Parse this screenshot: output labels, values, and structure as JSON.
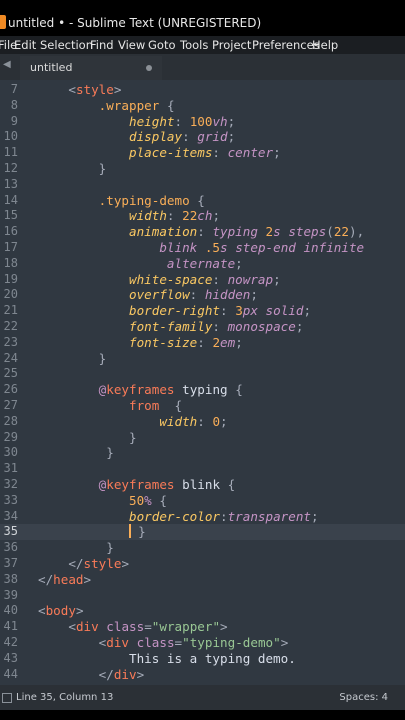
{
  "window": {
    "title": "untitled • - Sublime Text (UNREGISTERED)"
  },
  "menu": [
    "File",
    "Edit",
    "Selection",
    "Find",
    "View",
    "Goto",
    "Tools",
    "Project",
    "Preferences",
    "Help"
  ],
  "tab": {
    "label": "untitled"
  },
  "status": {
    "position": "Line 35, Column 13",
    "indentation": "Spaces: 4"
  },
  "active_line": 35,
  "code_lines": [
    {
      "n": 7,
      "html": "    <span class='angle'>&lt;</span><span class='tag'>style</span><span class='angle'>&gt;</span>"
    },
    {
      "n": 8,
      "html": "        <span class='sel'>.wrapper</span> <span class='punc'>{</span>"
    },
    {
      "n": 9,
      "html": "            <span class='prop'>height</span><span class='punc'>:</span> <span class='num'>100</span><span class='unit'>vh</span><span class='punc'>;</span>"
    },
    {
      "n": 10,
      "html": "            <span class='prop'>display</span><span class='punc'>:</span> <span class='val'>grid</span><span class='punc'>;</span>"
    },
    {
      "n": 11,
      "html": "            <span class='prop'>place-items</span><span class='punc'>:</span> <span class='val'>center</span><span class='punc'>;</span>"
    },
    {
      "n": 12,
      "html": "        <span class='punc'>}</span>"
    },
    {
      "n": 13,
      "html": ""
    },
    {
      "n": 14,
      "html": "        <span class='sel'>.typing-demo</span> <span class='punc'>{</span>"
    },
    {
      "n": 15,
      "html": "            <span class='prop'>width</span><span class='punc'>:</span> <span class='num'>22</span><span class='unit'>ch</span><span class='punc'>;</span>"
    },
    {
      "n": 16,
      "html": "            <span class='prop'>animation</span><span class='punc'>:</span> <span class='val'>typing</span> <span class='num'>2</span><span class='unit'>s</span> <span class='val'>steps</span><span class='punc'>(</span><span class='num'>22</span><span class='punc'>),</span>"
    },
    {
      "n": 17,
      "html": "                <span class='val'>blink</span> <span class='num'>.5</span><span class='unit'>s</span> <span class='val'>step-end</span> <span class='val'>infinite</span>"
    },
    {
      "n": 18,
      "html": "                 <span class='val'>alternate</span><span class='punc'>;</span>"
    },
    {
      "n": 19,
      "html": "            <span class='prop'>white-space</span><span class='punc'>:</span> <span class='val'>nowrap</span><span class='punc'>;</span>"
    },
    {
      "n": 20,
      "html": "            <span class='prop'>overflow</span><span class='punc'>:</span> <span class='val'>hidden</span><span class='punc'>;</span>"
    },
    {
      "n": 21,
      "html": "            <span class='prop'>border-right</span><span class='punc'>:</span> <span class='num'>3</span><span class='unit'>px</span> <span class='val'>solid</span><span class='punc'>;</span>"
    },
    {
      "n": 22,
      "html": "            <span class='prop'>font-family</span><span class='punc'>:</span> <span class='val'>monospace</span><span class='punc'>;</span>"
    },
    {
      "n": 23,
      "html": "            <span class='prop'>font-size</span><span class='punc'>:</span> <span class='num'>2</span><span class='unit'>em</span><span class='punc'>;</span>"
    },
    {
      "n": 24,
      "html": "        <span class='punc'>}</span>"
    },
    {
      "n": 25,
      "html": ""
    },
    {
      "n": 26,
      "html": "        <span class='at'>@</span><span class='tag'>keyframes</span> <span class='txt'>typing</span> <span class='punc'>{</span>"
    },
    {
      "n": 27,
      "html": "            <span class='tag'>from</span>  <span class='punc'>{</span>"
    },
    {
      "n": 28,
      "html": "                <span class='prop'>width</span><span class='punc'>:</span> <span class='num'>0</span><span class='punc'>;</span>"
    },
    {
      "n": 29,
      "html": "            <span class='punc'>}</span>"
    },
    {
      "n": 30,
      "html": "         <span class='punc'>}</span>"
    },
    {
      "n": 31,
      "html": ""
    },
    {
      "n": 32,
      "html": "        <span class='at'>@</span><span class='tag'>keyframes</span> <span class='txt'>blink</span> <span class='punc'>{</span>"
    },
    {
      "n": 33,
      "html": "            <span class='num'>50</span><span class='unit'>%</span> <span class='punc'>{</span>"
    },
    {
      "n": 34,
      "html": "            <span class='prop'>border-color</span><span class='punc'>:</span><span class='val'>transparent</span><span class='punc'>;</span>"
    },
    {
      "n": 35,
      "html": "            <span class='cursor'></span> <span class='punc'>}</span>"
    },
    {
      "n": 36,
      "html": "         <span class='punc'>}</span>"
    },
    {
      "n": 37,
      "html": "    <span class='angle'>&lt;/</span><span class='tag'>style</span><span class='angle'>&gt;</span>"
    },
    {
      "n": 38,
      "html": "<span class='angle'>&lt;/</span><span class='tag'>head</span><span class='angle'>&gt;</span>"
    },
    {
      "n": 39,
      "html": ""
    },
    {
      "n": 40,
      "html": "<span class='angle'>&lt;</span><span class='tag'>body</span><span class='angle'>&gt;</span>"
    },
    {
      "n": 41,
      "html": "    <span class='angle'>&lt;</span><span class='tag'>div</span> <span class='attr'>class</span><span class='punc'>=</span><span class='str'>\"wrapper\"</span><span class='angle'>&gt;</span>"
    },
    {
      "n": 42,
      "html": "        <span class='angle'>&lt;</span><span class='tag'>div</span> <span class='attr'>class</span><span class='punc'>=</span><span class='str'>\"typing-demo\"</span><span class='angle'>&gt;</span>"
    },
    {
      "n": 43,
      "html": "            <span class='txt'>This is a typing demo.</span>"
    },
    {
      "n": 44,
      "html": "        <span class='angle'>&lt;/</span><span class='tag'>div</span><span class='angle'>&gt;</span>"
    }
  ]
}
